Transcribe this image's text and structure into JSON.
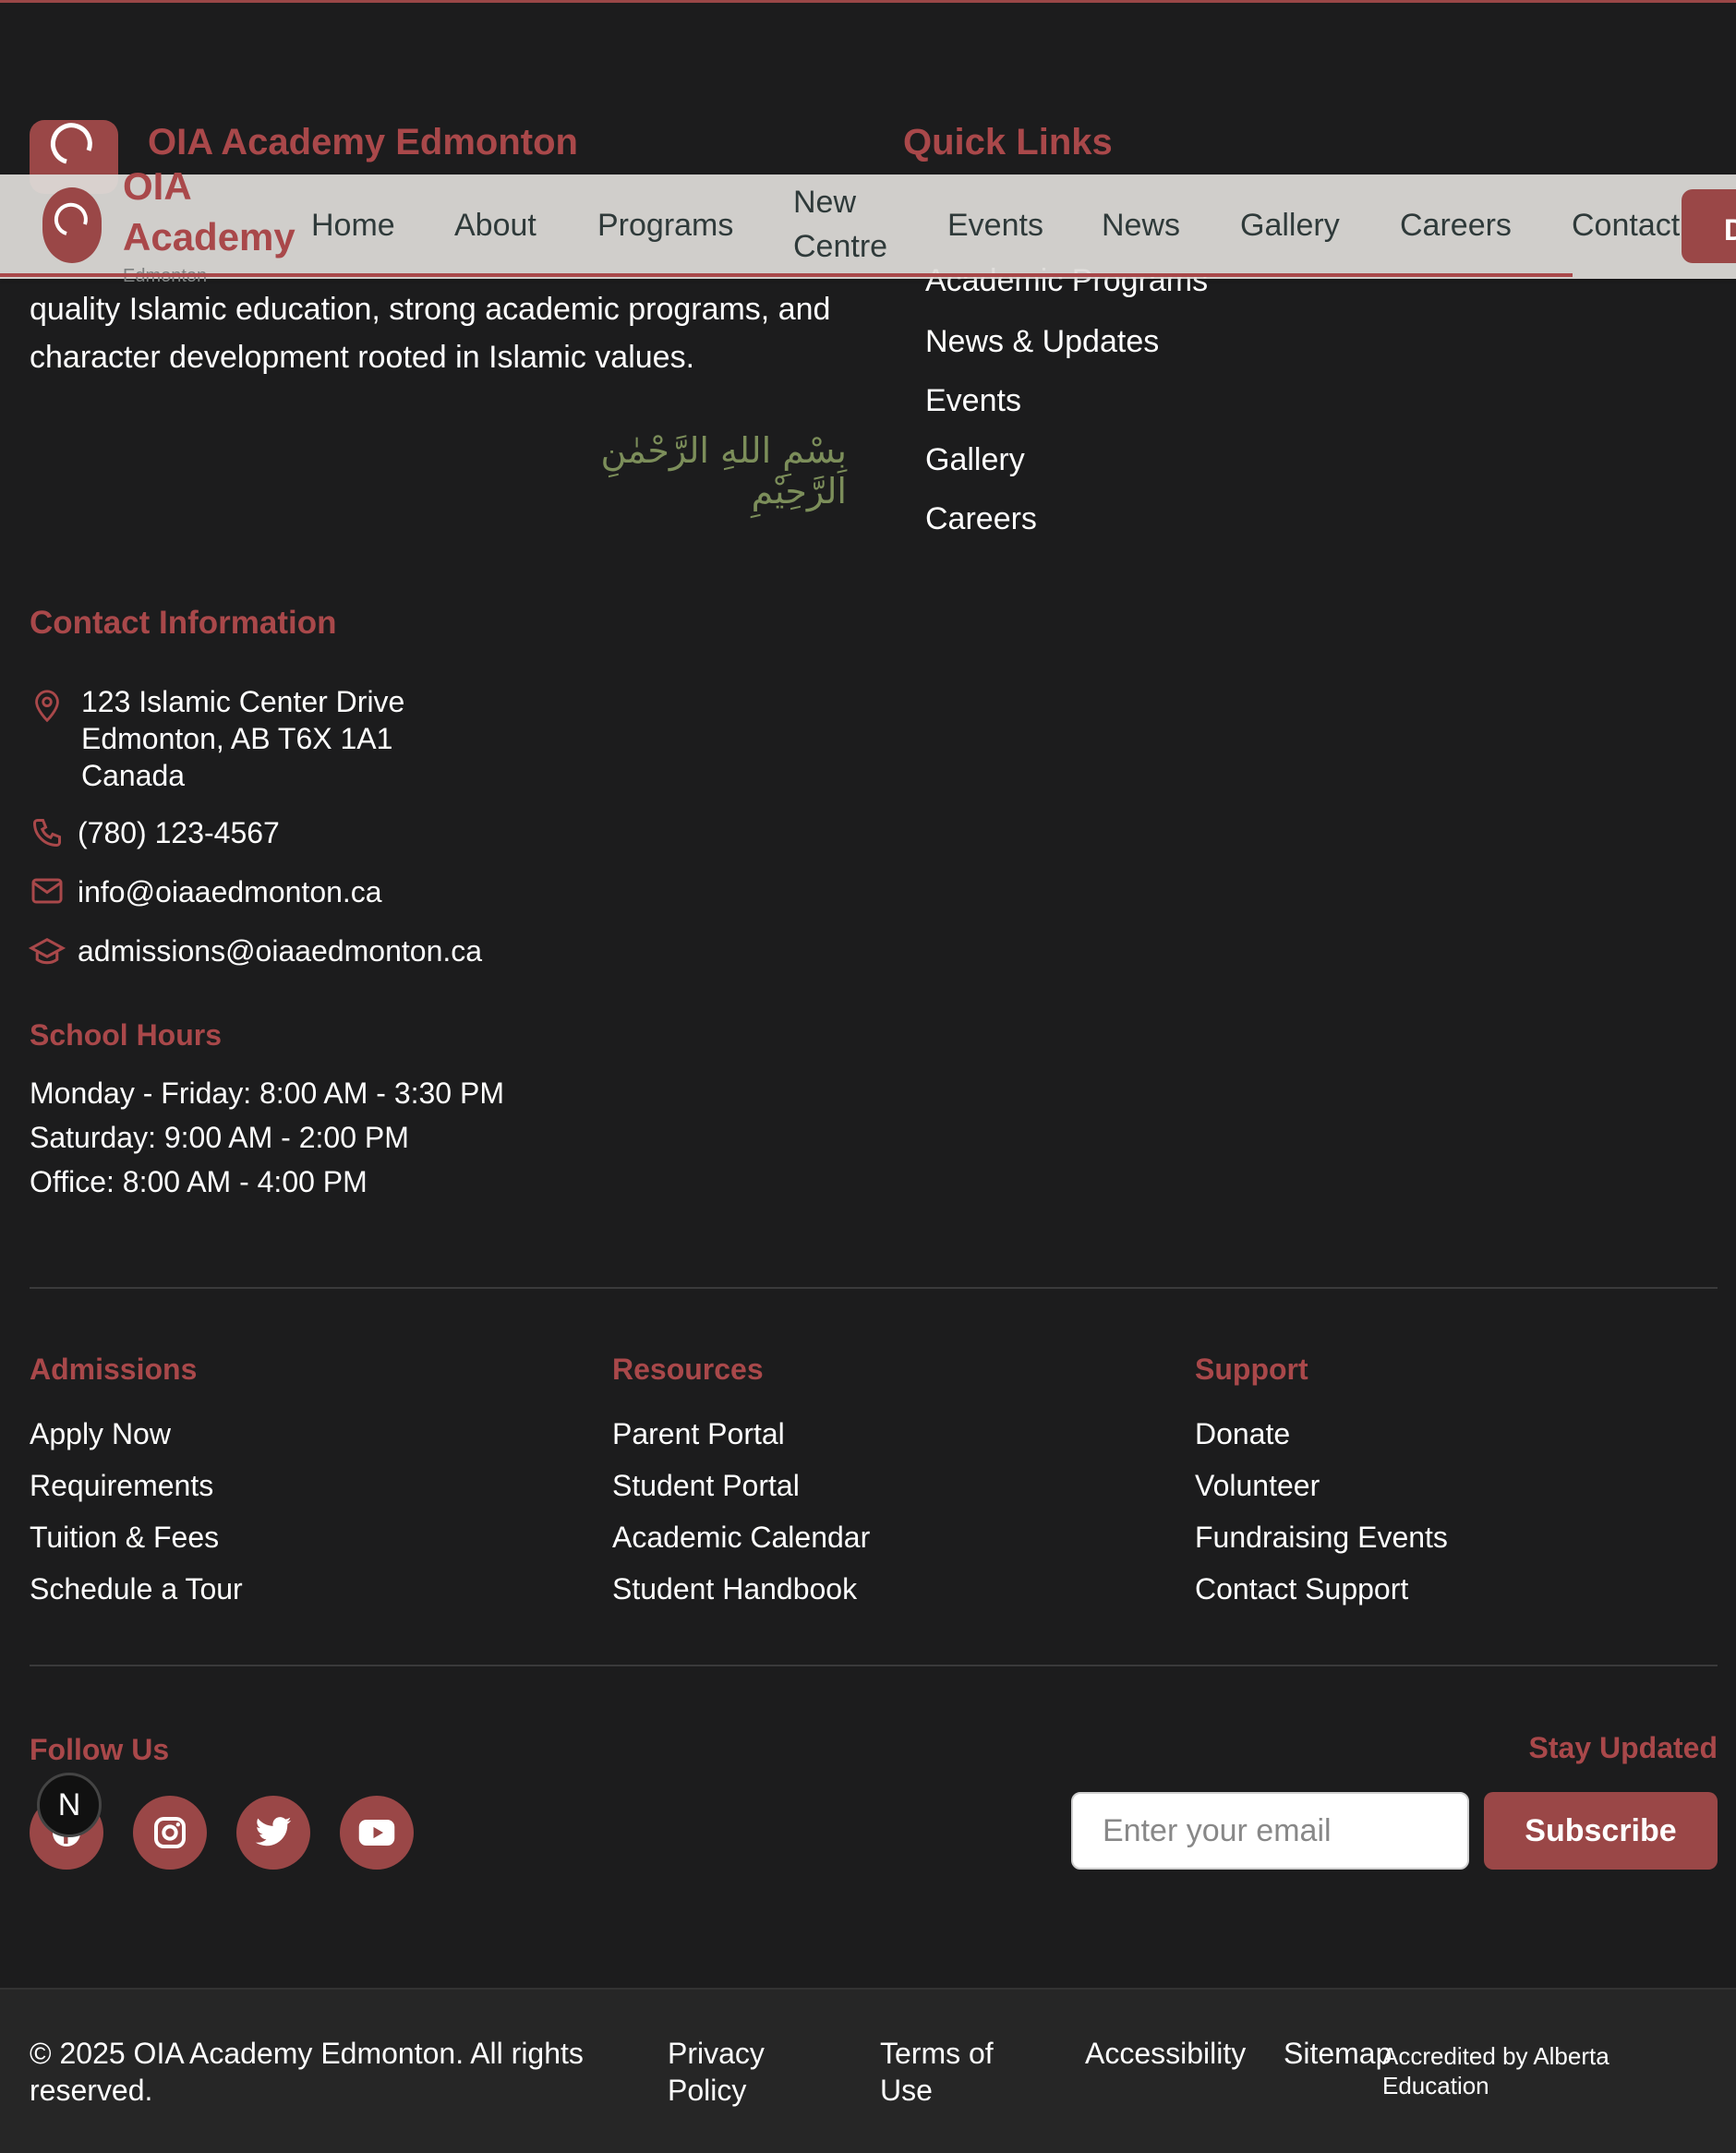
{
  "brand": {
    "name": "OIA Academy Edmonton",
    "nav_name_line1": "OIA",
    "nav_name_line2": "Academy",
    "nav_sub": "Edmonton",
    "description_line1": "quality Islamic education, strong academic programs, and",
    "description_line2": "character development rooted in Islamic values.",
    "bismillah": "بِسْمِ اللهِ الرَّحْمٰنِ الرَّحِيْمِ"
  },
  "nav": {
    "items": [
      {
        "label": "Home"
      },
      {
        "label": "About"
      },
      {
        "label": "Programs"
      },
      {
        "label_line1": "New",
        "label_line2": "Centre"
      },
      {
        "label": "Events"
      },
      {
        "label": "News"
      },
      {
        "label": "Gallery"
      },
      {
        "label": "Careers"
      },
      {
        "label": "Contact"
      }
    ],
    "donate_label": "D"
  },
  "quick_links": {
    "title": "Quick Links",
    "items": [
      "Academic Programs",
      "News & Updates",
      "Events",
      "Gallery",
      "Careers"
    ]
  },
  "contact": {
    "title": "Contact Information",
    "address_line1": "123 Islamic Center Drive",
    "address_line2": "Edmonton, AB T6X 1A1",
    "address_line3": "Canada",
    "phone": "(780) 123-4567",
    "email": "info@oiaaedmonton.ca",
    "admissions_email": "admissions@oiaaedmonton.ca"
  },
  "hours": {
    "title": "School Hours",
    "lines": [
      "Monday - Friday: 8:00 AM - 3:30 PM",
      "Saturday: 9:00 AM - 2:00 PM",
      "Office: 8:00 AM - 4:00 PM"
    ]
  },
  "admissions": {
    "title": "Admissions",
    "items": [
      "Apply Now",
      "Requirements",
      "Tuition & Fees",
      "Schedule a Tour"
    ]
  },
  "resources": {
    "title": "Resources",
    "items": [
      "Parent Portal",
      "Student Portal",
      "Academic Calendar",
      "Student Handbook"
    ]
  },
  "support": {
    "title": "Support",
    "items": [
      "Donate",
      "Volunteer",
      "Fundraising Events",
      "Contact Support"
    ]
  },
  "follow": {
    "title": "Follow Us",
    "icons": [
      "facebook-icon",
      "instagram-icon",
      "twitter-icon",
      "youtube-icon"
    ],
    "badge": "N"
  },
  "newsletter": {
    "title": "Stay Updated",
    "placeholder": "Enter your email",
    "button": "Subscribe"
  },
  "footer": {
    "copyright_line1": "© 2025 OIA Academy Edmonton. All rights",
    "copyright_line2": "reserved.",
    "privacy_line1": "Privacy",
    "privacy_line2": "Policy",
    "terms_line1": "Terms of",
    "terms_line2": "Use",
    "accessibility": "Accessibility",
    "sitemap": "Sitemap",
    "accredited_line1": "Accredited by Alberta",
    "accredited_line2": "Education"
  },
  "colors": {
    "accent": "#a9484a",
    "button": "#9a4747",
    "background": "#1c1c1d",
    "bismillah": "#7c8e5a"
  }
}
